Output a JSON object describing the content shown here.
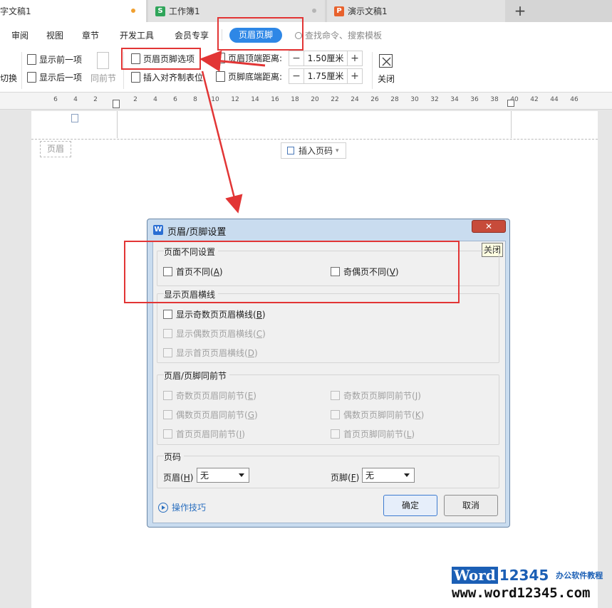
{
  "tabs": [
    {
      "label": "字文稿1",
      "icon": "",
      "icon_color": "",
      "active": true
    },
    {
      "label": "工作簿1",
      "icon": "S",
      "icon_color": "#2fa55a",
      "active": false
    },
    {
      "label": "演示文稿1",
      "icon": "P",
      "icon_color": "#e8612c",
      "active": false
    }
  ],
  "add_tab": "+",
  "menu": {
    "items": [
      "审阅",
      "视图",
      "章节",
      "开发工具",
      "会员专享"
    ],
    "active": "页眉页脚",
    "search": "查找命令、搜索模板"
  },
  "ribbon": {
    "switch_label": "切换",
    "show_prev": "显示前一项",
    "show_next": "显示后一项",
    "same_as_prev": "同前节",
    "hf_options": "页眉页脚选项",
    "insert_align_tab": "插入对齐制表位",
    "header_top_label": "页眉顶端距离:",
    "header_top_value": "1.50厘米",
    "footer_bottom_label": "页脚底端距离:",
    "footer_bottom_value": "1.75厘米",
    "minus": "−",
    "plus": "+",
    "close_label": "关闭"
  },
  "ruler": {
    "ticks": [
      "6",
      "4",
      "2",
      "2",
      "4",
      "6",
      "8",
      "10",
      "12",
      "14",
      "16",
      "18",
      "20",
      "22",
      "24",
      "26",
      "28",
      "30",
      "32",
      "34",
      "36",
      "38",
      "40",
      "42",
      "44",
      "46"
    ]
  },
  "page": {
    "header_tag": "页眉",
    "insert_page_number": "插入页码"
  },
  "dialog": {
    "title": "页眉/页脚设置",
    "close_tooltip": "关闭",
    "group1_title": "页面不同设置",
    "diff_first_page": {
      "text": "首页不同(",
      "key": "A",
      "end": ")"
    },
    "diff_odd_even": {
      "text": "奇偶页不同(",
      "key": "V",
      "end": ")"
    },
    "group2_title": "显示页眉横线",
    "show_odd_line": {
      "text": "显示奇数页页眉横线(",
      "key": "B",
      "end": ")"
    },
    "show_even_line": {
      "text": "显示偶数页页眉横线(",
      "key": "C",
      "end": ")"
    },
    "show_first_line": {
      "text": "显示首页页眉横线(",
      "key": "D",
      "end": ")"
    },
    "group3_title": "页眉/页脚同前节",
    "odd_header_same": {
      "text": "奇数页页眉同前节(",
      "key": "E",
      "end": ")"
    },
    "odd_footer_same": {
      "text": "奇数页页脚同前节(",
      "key": "J",
      "end": ")"
    },
    "even_header_same": {
      "text": "偶数页页眉同前节(",
      "key": "G",
      "end": ")"
    },
    "even_footer_same": {
      "text": "偶数页页脚同前节(",
      "key": "K",
      "end": ")"
    },
    "first_header_same": {
      "text": "首页页眉同前节(",
      "key": "I",
      "end": ")"
    },
    "first_footer_same": {
      "text": "首页页脚同前节(",
      "key": "L",
      "end": ")"
    },
    "group4_title": "页码",
    "header_select": {
      "label": "页眉(",
      "key": "H",
      "end": ")",
      "value": "无"
    },
    "footer_select": {
      "label": "页脚(",
      "key": "F",
      "end": ")",
      "value": "无"
    },
    "tips": "操作技巧",
    "ok": "确定",
    "cancel": "取消"
  },
  "watermark": {
    "brand": "Word",
    "digits": "12345",
    "subtitle": "办公软件教程",
    "url": "www.word12345.com"
  },
  "colors": {
    "accent": "#2e87e6",
    "annotation_red": "#e23535",
    "dialog_close": "#c74b3a"
  }
}
